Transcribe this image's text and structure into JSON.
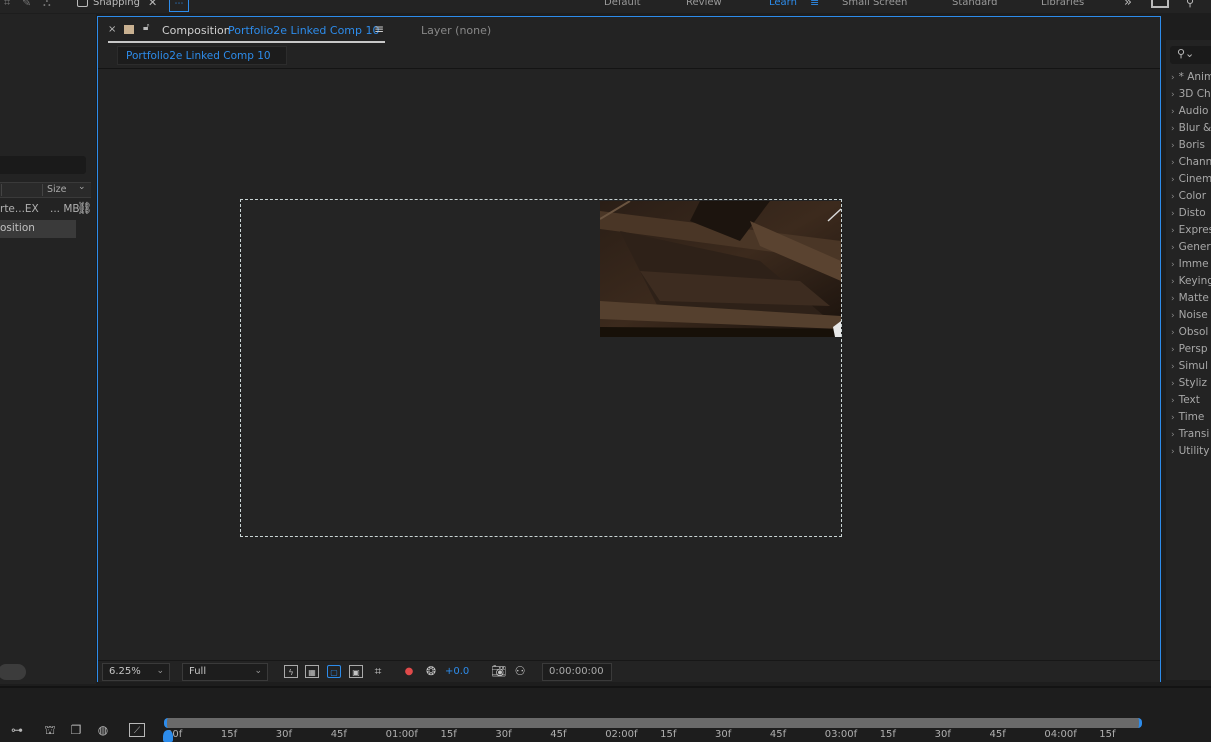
{
  "top_bar": {
    "snapping_label": "Snapping",
    "workspaces": [
      {
        "label": "Default",
        "active": false
      },
      {
        "label": "Review",
        "active": false
      },
      {
        "label": "Learn",
        "active": true
      },
      {
        "label": "Small Screen",
        "active": false
      },
      {
        "label": "Standard",
        "active": false
      },
      {
        "label": "Libraries",
        "active": false
      }
    ],
    "more_glyph": "»"
  },
  "project_panel": {
    "column_size_label": "Size",
    "row1_name": "rte...EX",
    "row1_size": "... MB",
    "row2_name": "osition"
  },
  "composition_panel": {
    "tab_prefix": "Composition",
    "tab_name": "Portfolio2e Linked Comp 10",
    "layer_tab": "Layer (none)",
    "sub_tab": "Portfolio2e Linked Comp 10",
    "footer": {
      "zoom": "6.25%",
      "resolution": "Full",
      "exposure": "+0.0",
      "timecode": "0:00:00:00"
    }
  },
  "effects_panel": {
    "items": [
      "* Anim",
      "3D Ch",
      "Audio",
      "Blur &",
      "Boris",
      "Chann",
      "Cinem",
      "Color",
      "Disto",
      "Expres",
      "Gener",
      "Imme",
      "Keying",
      "Matte",
      "Noise",
      "Obsol",
      "Persp",
      "Simul",
      "Styliz",
      "Text",
      "Time",
      "Transi",
      "Utility"
    ]
  },
  "timeline": {
    "ticks": [
      "00f",
      "15f",
      "30f",
      "45f",
      "01:00f",
      "15f",
      "30f",
      "45f",
      "02:00f",
      "15f",
      "30f",
      "45f",
      "03:00f",
      "15f",
      "30f",
      "45f",
      "04:00f",
      "15f"
    ]
  },
  "colors": {
    "accent": "#2d8ceb",
    "panel_bg": "#232323",
    "app_bg": "#1d1d1d"
  }
}
